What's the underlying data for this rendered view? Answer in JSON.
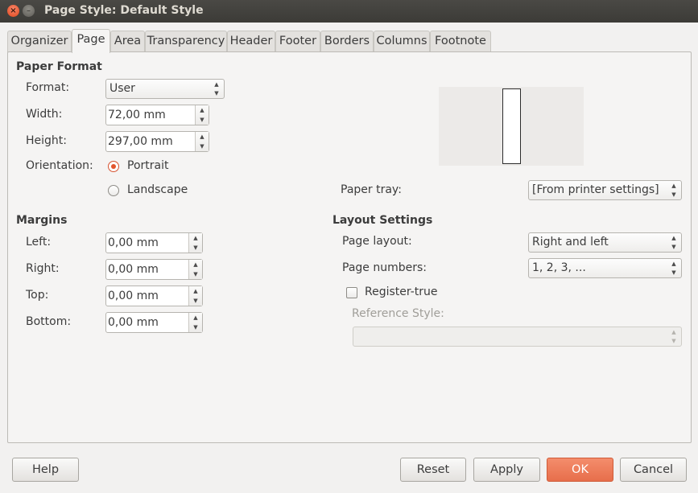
{
  "window": {
    "title": "Page Style: Default Style"
  },
  "tabs": [
    "Organizer",
    "Page",
    "Area",
    "Transparency",
    "Header",
    "Footer",
    "Borders",
    "Columns",
    "Footnote"
  ],
  "paper_format": {
    "heading": "Paper Format",
    "format_label": "Format:",
    "format_value": "User",
    "width_label": "Width:",
    "width_value": "72,00 mm",
    "height_label": "Height:",
    "height_value": "297,00 mm",
    "orientation_label": "Orientation:",
    "portrait_label": "Portrait",
    "landscape_label": "Landscape",
    "selected_orientation": "Portrait",
    "paper_tray_label": "Paper tray:",
    "paper_tray_value": "[From printer settings]"
  },
  "margins": {
    "heading": "Margins",
    "left_label": "Left:",
    "left_value": "0,00 mm",
    "right_label": "Right:",
    "right_value": "0,00 mm",
    "top_label": "Top:",
    "top_value": "0,00 mm",
    "bottom_label": "Bottom:",
    "bottom_value": "0,00 mm"
  },
  "layout_settings": {
    "heading": "Layout Settings",
    "page_layout_label": "Page layout:",
    "page_layout_value": "Right and left",
    "page_numbers_label": "Page numbers:",
    "page_numbers_value": "1, 2, 3, ...",
    "register_true_label": "Register-true",
    "register_true_checked": false,
    "reference_style_label": "Reference Style:",
    "reference_style_value": ""
  },
  "buttons": {
    "help": "Help",
    "reset": "Reset",
    "apply": "Apply",
    "ok": "OK",
    "cancel": "Cancel"
  },
  "icons": {
    "close": "close-icon",
    "minimize": "minimize-icon",
    "spin_up": "arrow-up-icon",
    "spin_down": "arrow-down-icon"
  },
  "colors": {
    "accent": "#e76e4b",
    "titlebar": "#3c3b37",
    "panel": "#f5f4f3"
  }
}
